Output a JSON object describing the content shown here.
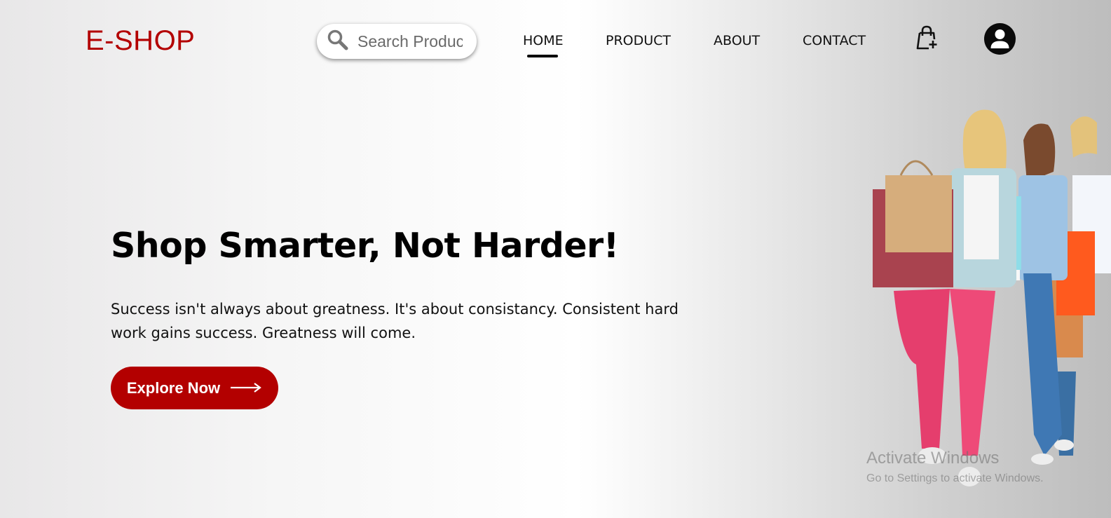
{
  "header": {
    "logo": "E-SHOP",
    "search_placeholder": "Search Products",
    "nav": [
      {
        "label": "HOME",
        "active": true
      },
      {
        "label": "PRODUCT",
        "active": false
      },
      {
        "label": "ABOUT",
        "active": false
      },
      {
        "label": "CONTACT",
        "active": false
      }
    ],
    "cart_icon": "shopping-bag-plus-icon",
    "user_icon": "user-circle-icon"
  },
  "hero": {
    "headline": "Shop Smarter, Not Harder!",
    "subtext": "Success isn't always about greatness. It's about consistancy. Consistent hard work gains success. Greatness will come.",
    "cta_label": "Explore Now",
    "cta_icon": "arrow-right-icon",
    "image": "women-with-shopping-bags"
  },
  "watermark": {
    "title": "Activate Windows",
    "subtitle": "Go to Settings to activate Windows."
  },
  "colors": {
    "brand": "#b30000",
    "text": "#000000"
  }
}
